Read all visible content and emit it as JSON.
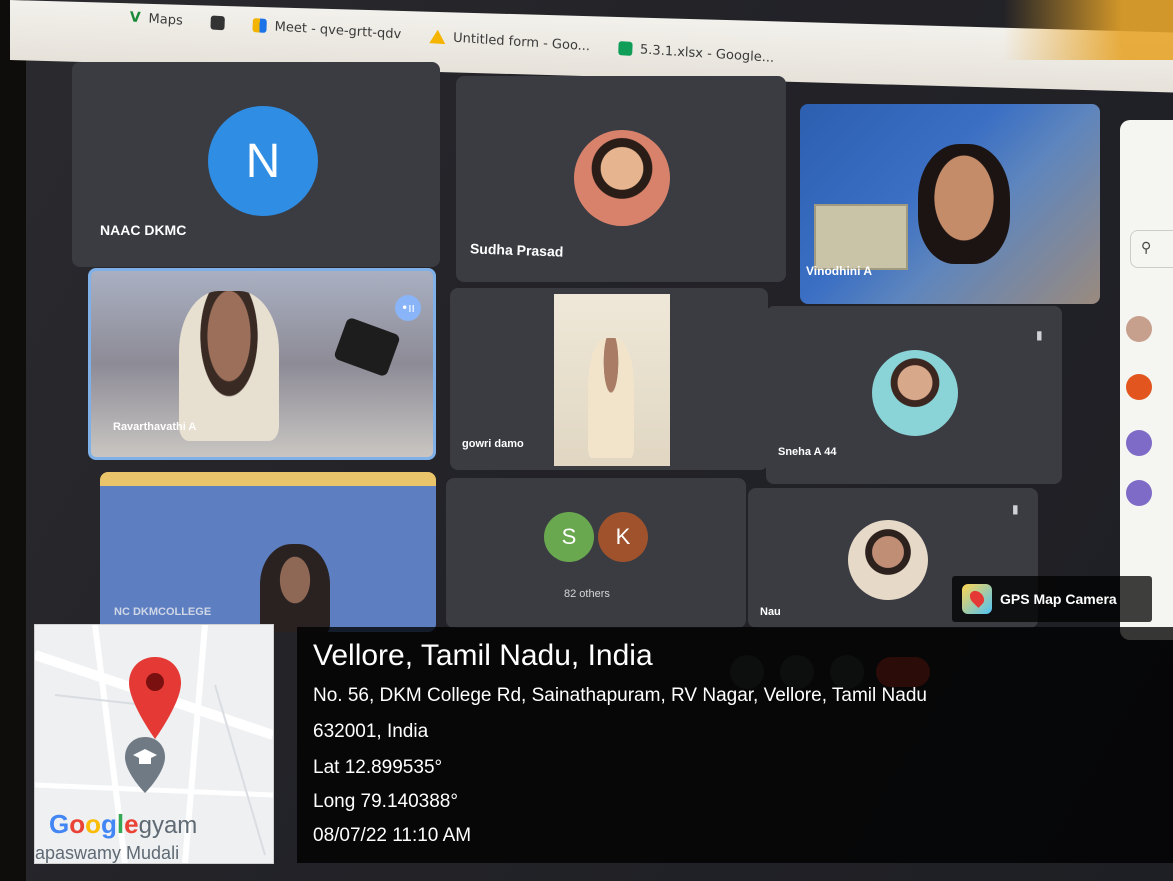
{
  "browser": {
    "bookmarks": [
      {
        "label": "Maps",
        "icon": "maps-icon"
      },
      {
        "label": "",
        "icon": "globe-icon"
      },
      {
        "label": "Meet - qve-grtt-qdv",
        "icon": "meet-icon"
      },
      {
        "label": "Untitled form - Goo...",
        "icon": "drive-icon"
      },
      {
        "label": "5.3.1.xlsx - Google...",
        "icon": "sheets-icon"
      }
    ]
  },
  "meet": {
    "tiles": [
      {
        "name": "NAAC DKMC",
        "avatar_letter": "N",
        "avatar_color": "#2f8de4"
      },
      {
        "name": "Sudha Prasad"
      },
      {
        "name": "Vinodhini A"
      },
      {
        "name": "Ravarthavathi A"
      },
      {
        "name": "gowri damo"
      },
      {
        "name": "Sneha A 44"
      },
      {
        "name": "NC DKMCOLLEGE"
      },
      {
        "name": "",
        "others_label": "82 others",
        "others_avatars": [
          {
            "letter": "S",
            "color": "#6aa84f"
          },
          {
            "letter": "K",
            "color": "#a0522d"
          }
        ]
      },
      {
        "name": "Nau"
      }
    ]
  },
  "gps": {
    "badge_label": "GPS Map Camera",
    "title": "Vellore, Tamil Nadu, India",
    "address_line1": "No. 56, DKM College Rd, Sainathapuram, RV Nagar, Vellore, Tamil Nadu",
    "address_line2": "632001, India",
    "lat": "Lat 12.899535°",
    "long": "Long 79.140388°",
    "datetime": "08/07/22 11:10 AM",
    "map_brand": "Google",
    "map_suffix": "gyam",
    "map_bottom": "apaswamy Mudali"
  },
  "colors": {
    "tile_bg": "#3a3c42",
    "active_border": "#7fb0e8",
    "pin_red": "#e53935"
  }
}
